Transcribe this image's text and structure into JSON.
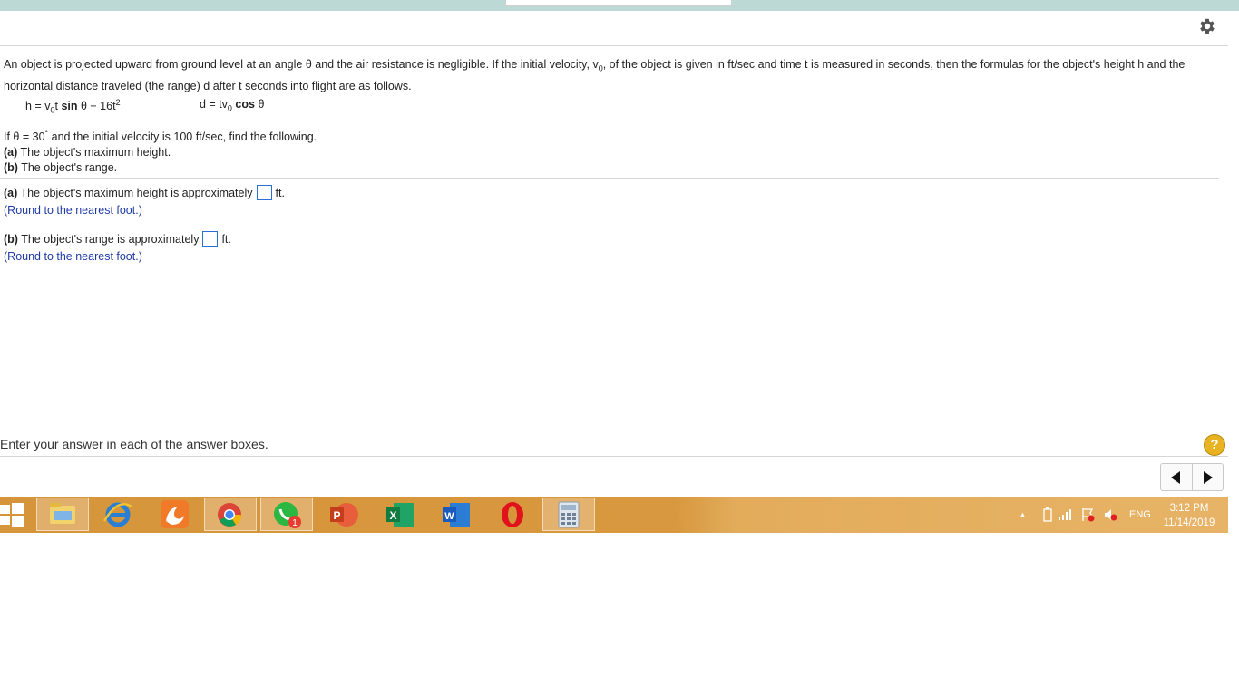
{
  "problem": {
    "intro_a": "An object is projected upward from ground level at an angle θ and the air resistance is negligible. If the initial velocity, v",
    "intro_sub": "0",
    "intro_b": ", of the object is given in ft/sec and time t is measured in seconds, then the formulas for the object's height h and the horizontal distance traveled (the range) d after t seconds into flight are as follows.",
    "formula_h": {
      "p1": "h = v",
      "sub": "0",
      "p2": "t",
      "bold": "sin",
      "p3": "θ − 16t",
      "sup": "2"
    },
    "formula_d": {
      "p1": "d = tv",
      "sub": "0",
      "bold": "cos",
      "p2": "θ"
    },
    "given": {
      "line1_a": "If θ = 30",
      "line1_sup": "°",
      "line1_b": " and the initial velocity is 100 ft/sec, find the following.",
      "a_label": "(a)",
      "a_text": " The object's maximum height.",
      "b_label": "(b)",
      "b_text": " The object's range."
    }
  },
  "answers": {
    "a": {
      "label": "(a)",
      "text": " The object's maximum height is approximately",
      "unit": "ft.",
      "hint": "(Round to the nearest foot.)",
      "value": ""
    },
    "b": {
      "label": "(b)",
      "text": " The object's range is approximately",
      "unit": "ft.",
      "hint": "(Round to the nearest foot.)",
      "value": ""
    }
  },
  "footer": {
    "instruction": "Enter your answer in each of the answer boxes.",
    "help": "?"
  },
  "taskbar": {
    "apps": [
      "start-icon",
      "file-manager-icon",
      "internet-explorer-icon",
      "uc-browser-icon",
      "chrome-icon",
      "whatsapp-icon",
      "powerpoint-icon",
      "excel-icon",
      "word-icon",
      "opera-icon",
      "calculator-icon"
    ],
    "whatsapp_badge": "1",
    "language": "ENG",
    "time": "3:12 PM",
    "date": "11/14/2019"
  },
  "colors": {
    "accent_bar": "#bcd9d6",
    "hint": "#1f3aa8",
    "input_border": "#2a6fd6",
    "taskbar": "#d6953a"
  }
}
